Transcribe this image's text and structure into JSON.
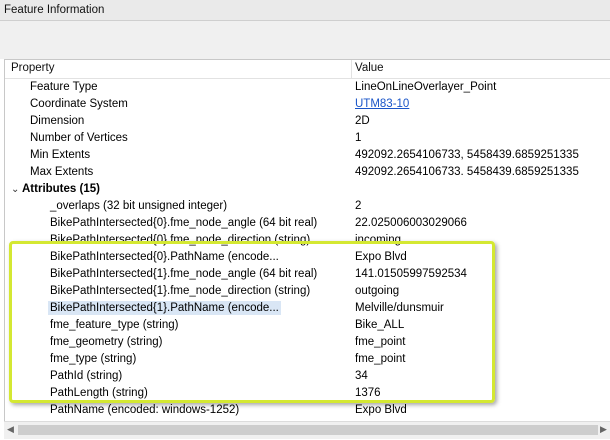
{
  "window": {
    "title": "Feature Information"
  },
  "table": {
    "columns": {
      "property": "Property",
      "value": "Value"
    },
    "rows": [
      {
        "property": "Feature Type",
        "value": "LineOnLineOverlayer_Point"
      },
      {
        "property": "Coordinate System",
        "value": "UTM83-10"
      },
      {
        "property": "Dimension",
        "value": "2D"
      },
      {
        "property": "Number of Vertices",
        "value": "1"
      },
      {
        "property": "Min Extents",
        "value": "492092.2654106733, 5458439.6859251335"
      },
      {
        "property": "Max Extents",
        "value": "492092.2654106733, 5458439.6859251335"
      }
    ],
    "group": {
      "toggle": "⌄",
      "label": "Attributes (15)",
      "items": [
        {
          "property": "_overlaps (32 bit unsigned integer)",
          "value": "2"
        },
        {
          "property": "BikePathIntersected{0}.fme_node_angle (64 bit real)",
          "value": "22.025006003029066"
        },
        {
          "property": "BikePathIntersected{0}.fme_node_direction (string)",
          "value": "incoming"
        },
        {
          "property": "BikePathIntersected{0}.PathName (encode...",
          "value": "Expo Blvd"
        },
        {
          "property": "BikePathIntersected{1}.fme_node_angle (64 bit real)",
          "value": "141.01505997592534"
        },
        {
          "property": "BikePathIntersected{1}.fme_node_direction (string)",
          "value": "outgoing"
        },
        {
          "property": "BikePathIntersected{1}.PathName (encode...",
          "value": "Melville/dunsmuir"
        },
        {
          "property": "fme_feature_type (string)",
          "value": "Bike_ALL"
        },
        {
          "property": "fme_geometry (string)",
          "value": "fme_point"
        },
        {
          "property": "fme_type (string)",
          "value": "fme_point"
        },
        {
          "property": "PathId (string)",
          "value": "34"
        },
        {
          "property": "PathLength (string)",
          "value": "1376"
        },
        {
          "property": "PathName (encoded: windows-1252)",
          "value": "Expo Blvd"
        }
      ]
    }
  },
  "colors": {
    "highlight": "#d4e832",
    "link": "#1a55c8",
    "selected_row": "#d9e6f5"
  }
}
